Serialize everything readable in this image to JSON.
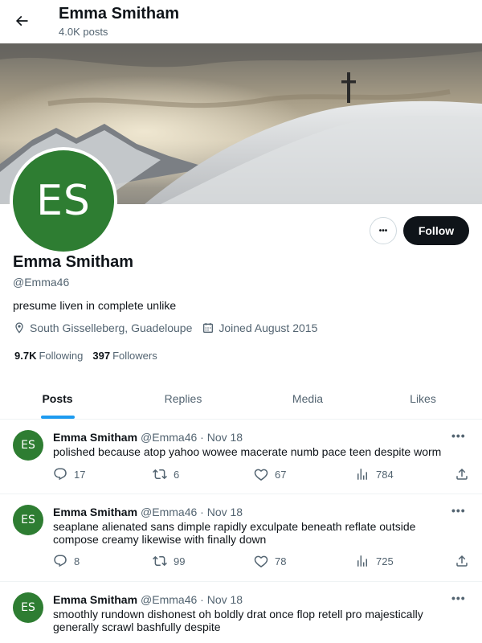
{
  "header": {
    "title": "Emma Smitham",
    "subtitle": "4.0K posts"
  },
  "profile": {
    "avatar_initials": "ES",
    "avatar_color": "#2e7d32",
    "more_label": "•••",
    "follow_label": "Follow",
    "name": "Emma Smitham",
    "handle": "@Emma46",
    "bio": "presume liven in complete unlike",
    "location": "South Gisselleberg, Guadeloupe",
    "joined": "Joined August 2015",
    "following_count": "9.7K",
    "following_label": "Following",
    "followers_count": "397",
    "followers_label": "Followers"
  },
  "tabs": [
    {
      "label": "Posts",
      "active": true
    },
    {
      "label": "Replies",
      "active": false
    },
    {
      "label": "Media",
      "active": false
    },
    {
      "label": "Likes",
      "active": false
    }
  ],
  "tweets": [
    {
      "initials": "ES",
      "name": "Emma Smitham",
      "handle": "@Emma46",
      "date": " · Nov 18",
      "text": "polished because atop yahoo wowee macerate numb pace teen despite worm",
      "replies": "17",
      "reposts": "6",
      "likes": "67",
      "views": "784"
    },
    {
      "initials": "ES",
      "name": "Emma Smitham",
      "handle": "@Emma46",
      "date": " · Nov 18",
      "text": "seaplane alienated sans dimple rapidly exculpate beneath reflate outside compose creamy likewise with finally down",
      "replies": "8",
      "reposts": "99",
      "likes": "78",
      "views": "725"
    },
    {
      "initials": "ES",
      "name": "Emma Smitham",
      "handle": "@Emma46",
      "date": " · Nov 18",
      "text": "smoothly rundown dishonest oh boldly drat once flop retell pro majestically generally scrawl bashfully despite"
    }
  ],
  "colors": {
    "accent": "#1d9bf0",
    "avatar": "#2e7d32",
    "text_primary": "#0f1419",
    "text_secondary": "#536471"
  }
}
